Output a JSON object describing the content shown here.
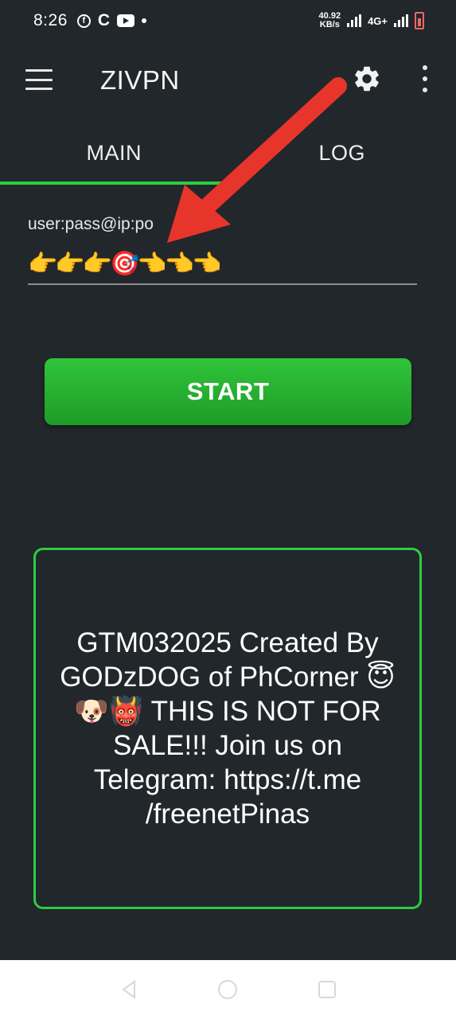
{
  "status_bar": {
    "time": "8:26",
    "net_speed_value": "40.92",
    "net_speed_unit": "KB/s",
    "network_type": "4G+"
  },
  "app_bar": {
    "title": "ZIVPN",
    "icons": [
      "menu-icon",
      "gear-icon",
      "more-vert-icon"
    ]
  },
  "tabs": [
    {
      "label": "MAIN",
      "active": true
    },
    {
      "label": "LOG",
      "active": false
    }
  ],
  "server_input": {
    "label": "user:pass@ip:po",
    "value": "👉👉👉🎯👈👈👈"
  },
  "start_button": {
    "label": "START"
  },
  "message": {
    "text": "GTM032025 Created By GODzDOG of PhCorner 😇🐶👹 THIS IS NOT FOR SALE!!! Join us on Telegram: https://t.me /freenetPinas"
  },
  "colors": {
    "background": "#22272b",
    "accent_green": "#2ecc40",
    "button_green": "#27b131",
    "arrow_red": "#e8352b"
  },
  "nav_bar": {
    "icons": [
      "back-icon",
      "home-icon",
      "recents-icon"
    ]
  }
}
